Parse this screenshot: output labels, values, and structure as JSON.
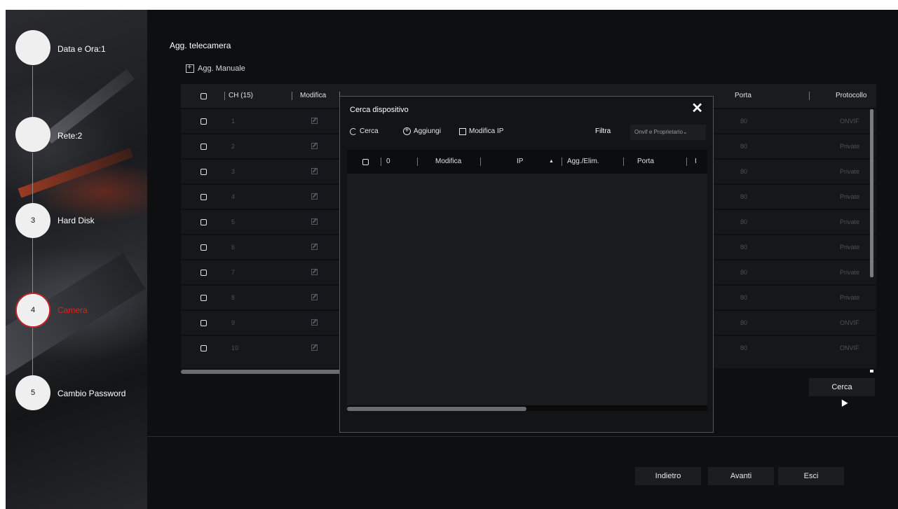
{
  "steps": [
    {
      "num": "",
      "label": "Data e Ora:1"
    },
    {
      "num": "",
      "label": "Rete:2"
    },
    {
      "num": "3",
      "label": "Hard Disk"
    },
    {
      "num": "4",
      "label": "Camera"
    },
    {
      "num": "5",
      "label": "Cambio Password"
    }
  ],
  "page": {
    "title": "Agg. telecamera",
    "add_manual": "Agg. Manuale"
  },
  "table": {
    "headers": {
      "ch": "CH (15)",
      "modify": "Modifica",
      "port": "Porta",
      "protocol": "Protocollo"
    },
    "rows": [
      {
        "ch": "1",
        "port": "80",
        "protocol": "ONVIF"
      },
      {
        "ch": "2",
        "port": "80",
        "protocol": "Private"
      },
      {
        "ch": "3",
        "port": "80",
        "protocol": "Private"
      },
      {
        "ch": "4",
        "port": "80",
        "protocol": "Private"
      },
      {
        "ch": "5",
        "port": "80",
        "protocol": "Private"
      },
      {
        "ch": "6",
        "port": "80",
        "protocol": "Private"
      },
      {
        "ch": "7",
        "port": "80",
        "protocol": "Private"
      },
      {
        "ch": "8",
        "port": "80",
        "protocol": "Private"
      },
      {
        "ch": "9",
        "port": "80",
        "protocol": "ONVIF"
      },
      {
        "ch": "10",
        "port": "80",
        "protocol": "ONVIF"
      }
    ]
  },
  "search_button": "Cerca",
  "dialog": {
    "title": "Cerca dispositivo",
    "close": "✕",
    "toolbar": {
      "search": "Cerca",
      "add": "Aggiungi",
      "edit_ip": "Modifica IP",
      "filter_label": "Filtra",
      "filter_value": "Onvif e Proprietario"
    },
    "headers": {
      "count": "0",
      "modify": "Modifica",
      "ip": "IP",
      "sort": "▲",
      "add_del": "Agg./Elim.",
      "port": "Porta",
      "next": "I"
    }
  },
  "footer": {
    "back": "Indietro",
    "next": "Avanti",
    "exit": "Esci"
  }
}
